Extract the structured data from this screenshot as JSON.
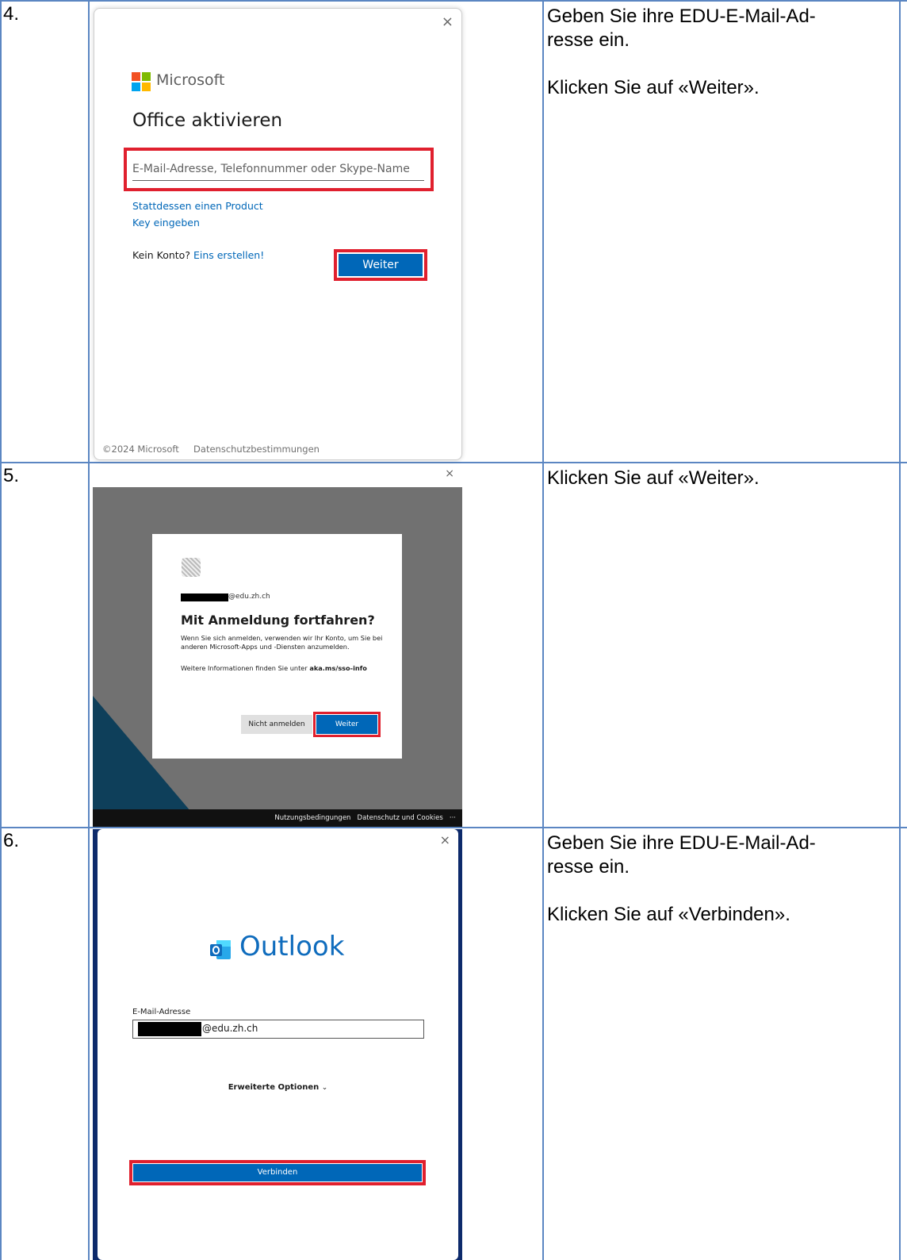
{
  "rows": [
    {
      "number": "4.",
      "instructions": [
        "Geben Sie ihre EDU-E-Mail-Ad-\nresse ein.",
        "Klicken Sie auf «Weiter»."
      ]
    },
    {
      "number": "5.",
      "instructions": [
        "Klicken Sie auf «Weiter»."
      ]
    },
    {
      "number": "6.",
      "instructions": [
        "Geben Sie ihre EDU-E-Mail-Ad-\nresse ein.",
        "Klicken Sie auf «Verbinden»."
      ]
    }
  ],
  "shot1": {
    "close_glyph": "×",
    "brand": "Microsoft",
    "title": "Office aktivieren",
    "email_placeholder": "E-Mail-Adresse, Telefonnummer oder Skype-Name",
    "product_key_line1": "Stattdessen einen Product",
    "product_key_line2": "Key eingeben",
    "no_account": "Kein Konto?",
    "create_account": "Eins erstellen!",
    "next_button": "Weiter",
    "copyright": "©2024 Microsoft",
    "privacy": "Datenschutzbestimmungen"
  },
  "shot2": {
    "close_glyph": "×",
    "email_suffix": "@edu.zh.ch",
    "title": "Mit Anmeldung fortfahren?",
    "body": "Wenn Sie sich anmelden, verwenden wir Ihr Konto, um Sie bei anderen Microsoft-Apps und -Diensten anzumelden.",
    "info_prefix": "Weitere Informationen finden Sie unter",
    "info_link": "aka.ms/sso-info",
    "decline_button": "Nicht anmelden",
    "next_button": "Weiter",
    "footer_terms": "Nutzungsbedingungen",
    "footer_privacy": "Datenschutz und Cookies",
    "footer_more": "···"
  },
  "shot3": {
    "close_glyph": "×",
    "app_name": "Outlook",
    "email_label": "E-Mail-Adresse",
    "email_suffix": "@edu.zh.ch",
    "advanced_options": "Erweiterte Optionen",
    "advanced_chevron": "⌄",
    "connect_button": "Verbinden"
  },
  "colors": {
    "grid": "#5b86c2",
    "highlight": "#e0202e",
    "ms_blue": "#0067b8",
    "outlook_blue": "#0f6cbd"
  }
}
